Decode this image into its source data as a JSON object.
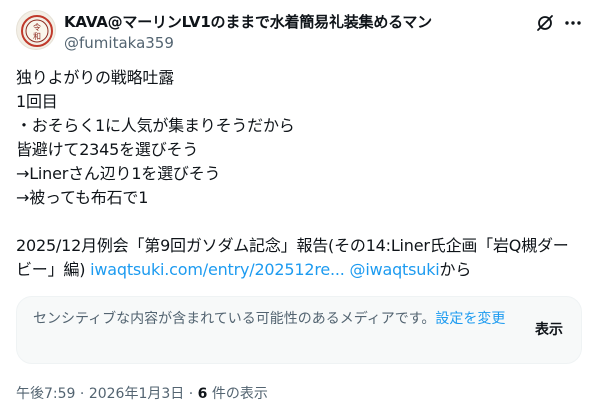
{
  "author": {
    "name": "KAVA@マーリンLV1のままで水着簡易礼装集めるマン",
    "handle": "@fumitaka359",
    "avatar_text": "令和"
  },
  "header_icons": [
    "grok-icon",
    "more-icon"
  ],
  "tweet": {
    "lines": [
      "独りよがりの戦略吐露",
      "1回目",
      "・おそらく1に人気が集まりそうだから",
      "皆避けて2345を選びそう",
      "→Linerさん辺り1を選びそう",
      "→被っても布石で1"
    ],
    "share_line1": "2025/12月例会「第9回ガソダム記念」報告(その14:Liner氏企画「岩Q槻ダー",
    "share_line2_prefix": "ビー」編) ",
    "share_url": "iwaqtsuki.com/entry/202512re...",
    "share_mention": "@iwaqtsuki",
    "share_suffix": "から"
  },
  "sensitive": {
    "message": "センシティブな内容が含まれている可能性のあるメディアです。",
    "settings_link": "設定を変更",
    "show_label": "表示"
  },
  "meta": {
    "time": "午後7:59",
    "date": "2026年1月3日",
    "views_count": "6",
    "views_label": "件の表示",
    "separator": "·"
  }
}
